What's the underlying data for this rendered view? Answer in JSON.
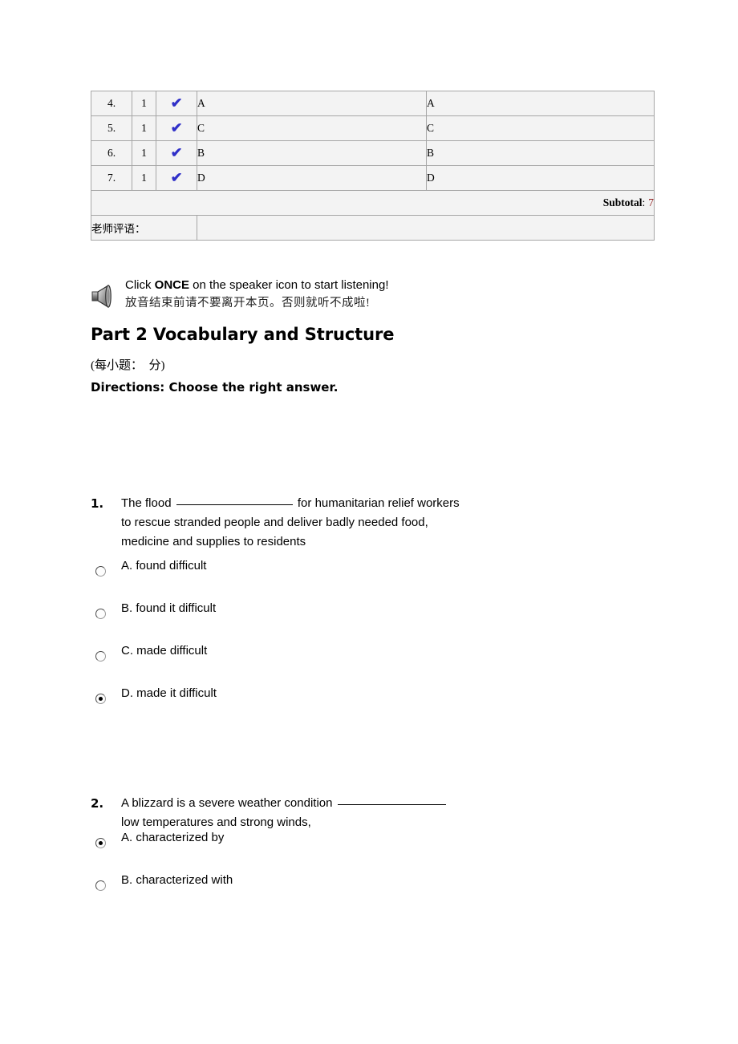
{
  "score_table": {
    "rows": [
      {
        "number": "4.",
        "points": "1",
        "mark": "check",
        "student_answer": "A",
        "correct_answer": "A"
      },
      {
        "number": "5.",
        "points": "1",
        "mark": "check",
        "student_answer": "C",
        "correct_answer": "C"
      },
      {
        "number": "6.",
        "points": "1",
        "mark": "check",
        "student_answer": "B",
        "correct_answer": "B"
      },
      {
        "number": "7.",
        "points": "1",
        "mark": "check",
        "student_answer": "D",
        "correct_answer": "D"
      }
    ],
    "subtotal_label": "Subtotal",
    "subtotal_colon": ":",
    "subtotal_value": "7",
    "subtotal_value_color": "#922424",
    "check_color": "#2f2fc8",
    "comment_label": "老师评语：",
    "comment_value": ""
  },
  "speaker_notice": {
    "icon": "speaker-icon",
    "line1_prefix": "Click ",
    "line1_emphasis": "ONCE",
    "line1_suffix": " on the speaker icon to start listening!",
    "line2": "放音结束前请不要离开本页。否则就听不成啦!"
  },
  "part": {
    "heading": "Part 2 Vocabulary and Structure",
    "subheading": "(每小题：  分)",
    "directions": "Directions: Choose the right answer."
  },
  "questions": [
    {
      "number": "1.",
      "stem_before_blank": "The flood",
      "stem_after_blank": "for humanitarian relief workers",
      "stem_line2": "to rescue stranded people and deliver badly needed food,",
      "stem_line3": "medicine and supplies to residents",
      "options": [
        {
          "label": "A. found difficult",
          "selected": false
        },
        {
          "label": "B. found it difficult",
          "selected": false
        },
        {
          "label": "C. made difficult",
          "selected": false
        },
        {
          "label": "D. made it difficult",
          "selected": true
        }
      ]
    },
    {
      "number": "2.",
      "stem_before_blank": "A blizzard is a severe weather condition",
      "stem_after_blank": "",
      "stem_line2": "low temperatures and strong winds,",
      "stem_line3": "",
      "options": [
        {
          "label": "A. characterized by",
          "selected": true
        },
        {
          "label": "B. characterized with",
          "selected": false
        }
      ]
    }
  ]
}
